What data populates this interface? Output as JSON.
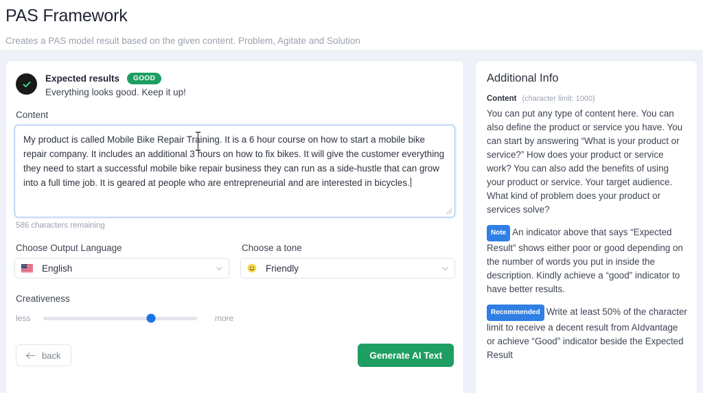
{
  "header": {
    "title": "PAS Framework",
    "subtitle": "Creates a PAS model result based on the given content. Problem, Agitate and Solution"
  },
  "expected_results": {
    "title": "Expected results",
    "badge": "GOOD",
    "badge_color": "#1e9e62",
    "message": "Everything looks good. Keep it up!",
    "icon": "check-circle-icon"
  },
  "content_field": {
    "label": "Content",
    "value": "My product is called Mobile Bike Repair Training. It is a 6 hour course on how to start a mobile bike repair company. It includes an additional 3 hours on how to fix bikes. It will give the customer everything they need to start a successful mobile bike repair business they can run as a side-hustle that can grow into a full time job. It is geared at people who are entrepreneurial and are interested in bicycles.",
    "placeholder": "",
    "characters_remaining": "586 characters remaining"
  },
  "language_select": {
    "label": "Choose Output Language",
    "value": "English",
    "icon": "us-flag-icon"
  },
  "tone_select": {
    "label": "Choose a tone",
    "value": "Friendly",
    "icon": "smiley-face-icon"
  },
  "creativeness": {
    "label": "Creativeness",
    "min_label": "less",
    "max_label": "more",
    "value_percent": 70,
    "thumb_color": "#1a73e8"
  },
  "footer": {
    "back_label": "back",
    "back_icon": "arrow-left-icon",
    "generate_label": "Generate AI Text",
    "generate_color": "#1e9e62"
  },
  "sidebar": {
    "title": "Additional Info",
    "content_heading": "Content",
    "content_limit": "(character limit: 1000)",
    "content_paragraph": "You can put any type of content here. You can also define the product or service you have. You can start by answering “What is your product or service?” How does your product or service work? You can also add the benefits of using your product or service. Your target audience. What kind of problem does your product or services solve?",
    "note_tag": "Note",
    "note_paragraph": "An indicator above that says “Expected Result” shows either poor or good depending on the number of words you put in inside the description. Kindly achieve a “good” indicator to have better results.",
    "recommended_tag": "Recommended",
    "recommended_paragraph": "Write at least 50% of the character limit to receive a decent result from AIdvantage or achieve “Good” indicator beside the Expected Result",
    "tag_color": "#2f7fe4"
  }
}
